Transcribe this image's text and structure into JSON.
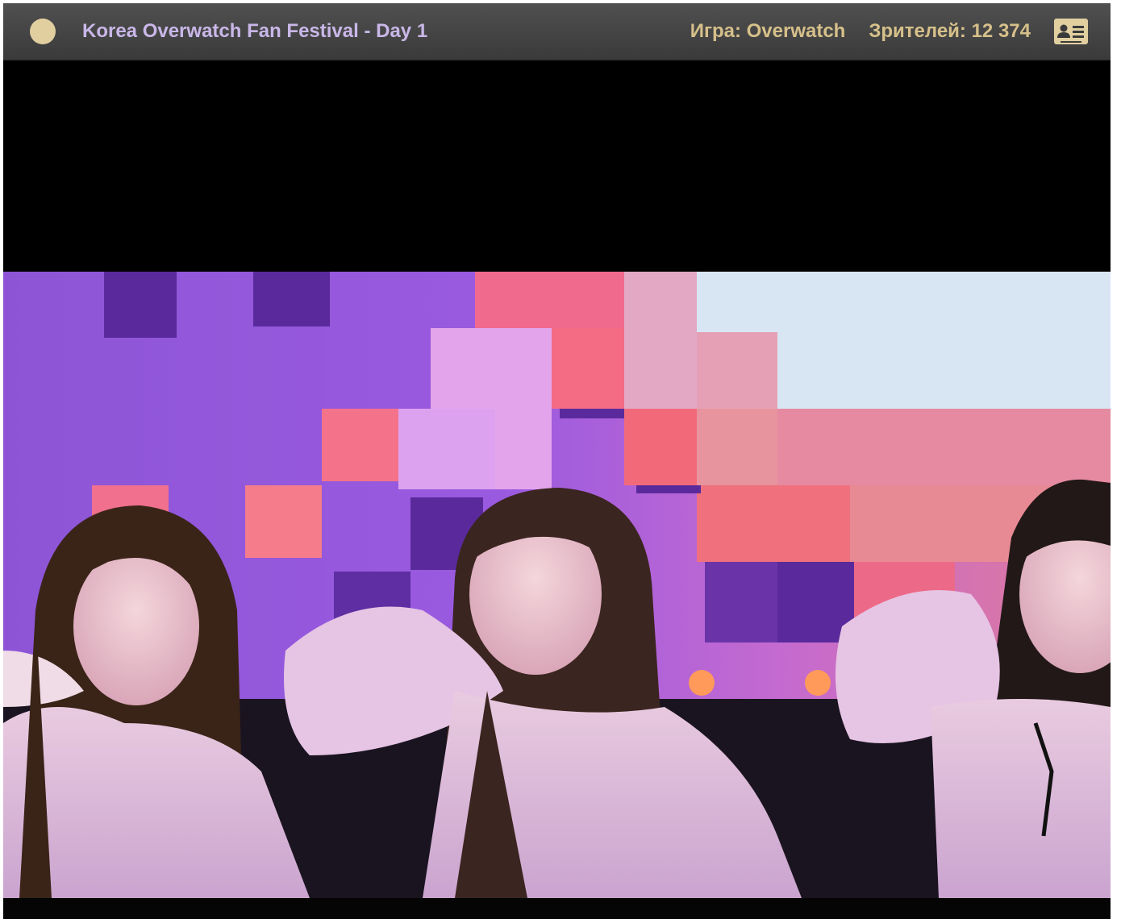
{
  "player": {
    "title": "Korea Overwatch Fan Festival - Day 1",
    "game_label": "Игра: Overwatch",
    "viewers_label": "Зрителей: 12 374",
    "status_icon": "status-dot-icon",
    "profile_icon": "profile-card-icon"
  },
  "colors": {
    "header_bg": "#434343",
    "title_color": "#c9b7e8",
    "meta_color": "#d6c08a",
    "accent": "#e1cfa0"
  }
}
